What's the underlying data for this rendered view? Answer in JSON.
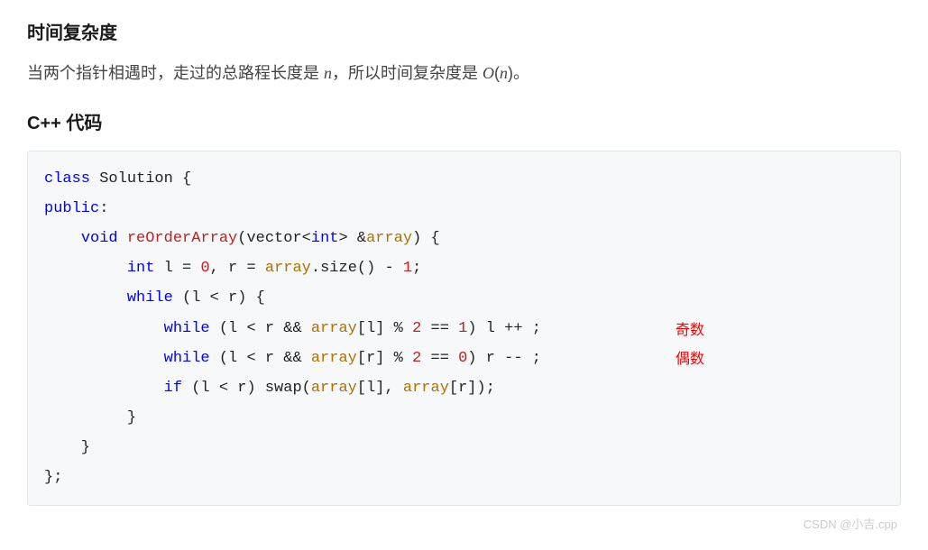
{
  "heading1": "时间复杂度",
  "paragraph": {
    "part1": "当两个指针相遇时，走过的总路程长度是 ",
    "math_n": "n",
    "part2": "，所以时间复杂度是 ",
    "math_O": "O",
    "math_open": "(",
    "math_n2": "n",
    "math_close": ")",
    "part3": "。"
  },
  "heading2": "C++ 代码",
  "code": {
    "line1_kw1": "class",
    "line1_rest": " Solution {",
    "line2_kw1": "public",
    "line2_rest": ":",
    "line3_indent": "    ",
    "line3_kw1": "void",
    "line3_sp1": " ",
    "line3_fn": "reOrderArray",
    "line3_rest1": "(vector<",
    "line3_kw2": "int",
    "line3_rest2": "> &",
    "line3_type": "array",
    "line3_rest3": ") {",
    "line4_indent": "         ",
    "line4_kw1": "int",
    "line4_rest1": " l = ",
    "line4_num1": "0",
    "line4_rest2": ", r = ",
    "line4_type": "array",
    "line4_rest3": ".size() - ",
    "line4_num2": "1",
    "line4_rest4": ";",
    "line5_indent": "         ",
    "line5_kw1": "while",
    "line5_rest": " (l < r) {",
    "line6_indent": "             ",
    "line6_kw1": "while",
    "line6_rest1": " (l < r && ",
    "line6_type": "array",
    "line6_rest2": "[l] % ",
    "line6_num1": "2",
    "line6_rest3": " == ",
    "line6_num2": "1",
    "line6_rest4": ") l ++ ;",
    "line7_indent": "             ",
    "line7_kw1": "while",
    "line7_rest1": " (l < r && ",
    "line7_type": "array",
    "line7_rest2": "[r] % ",
    "line7_num1": "2",
    "line7_rest3": " == ",
    "line7_num2": "0",
    "line7_rest4": ") r -- ;",
    "line8_indent": "             ",
    "line8_kw1": "if",
    "line8_rest1": " (l < r) swap(",
    "line8_type1": "array",
    "line8_rest2": "[l], ",
    "line8_type2": "array",
    "line8_rest3": "[r]);",
    "line9": "         }",
    "line10": "    }",
    "line11": "};"
  },
  "annotations": {
    "ann1": "奇数",
    "ann2": "偶数"
  },
  "watermark": "CSDN @小吉.cpp"
}
